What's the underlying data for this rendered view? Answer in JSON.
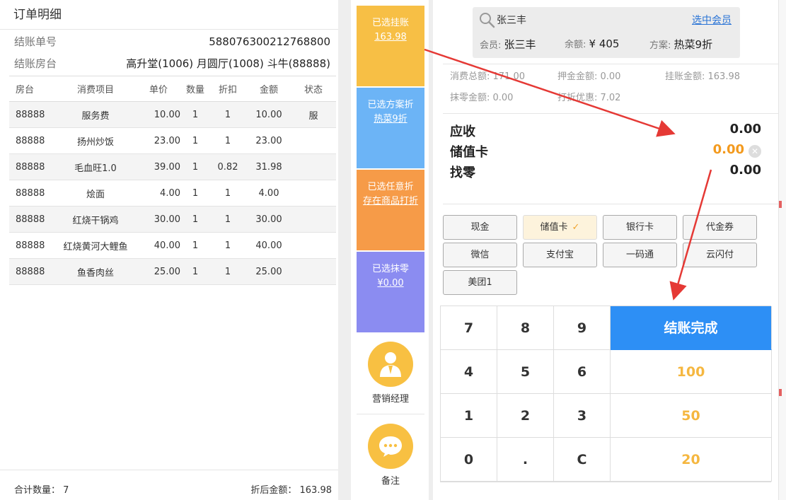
{
  "order": {
    "title": "订单明细",
    "no_label": "结账单号",
    "no_value": "588076300212768800",
    "rooms_label": "结账房台",
    "rooms_value": "高升堂(1006) 月圆厅(1008) 斗牛(88888)",
    "columns": [
      "房台",
      "消费项目",
      "单价",
      "数量",
      "折扣",
      "金额",
      "状态"
    ],
    "rows": [
      {
        "room": "88888",
        "item": "服务费",
        "price": "10.00",
        "qty": "1",
        "discount": "1",
        "amount": "10.00",
        "status": "服"
      },
      {
        "room": "88888",
        "item": "扬州炒饭",
        "price": "23.00",
        "qty": "1",
        "discount": "1",
        "amount": "23.00",
        "status": ""
      },
      {
        "room": "88888",
        "item": "毛血旺1.0",
        "price": "39.00",
        "qty": "1",
        "discount": "0.82",
        "amount": "31.98",
        "status": ""
      },
      {
        "room": "88888",
        "item": "烩面",
        "price": "4.00",
        "qty": "1",
        "discount": "1",
        "amount": "4.00",
        "status": ""
      },
      {
        "room": "88888",
        "item": "红烧干锅鸡",
        "price": "30.00",
        "qty": "1",
        "discount": "1",
        "amount": "30.00",
        "status": ""
      },
      {
        "room": "88888",
        "item": "红烧黄河大鲤鱼",
        "price": "40.00",
        "qty": "1",
        "discount": "1",
        "amount": "40.00",
        "status": ""
      },
      {
        "room": "88888",
        "item": "鱼香肉丝",
        "price": "25.00",
        "qty": "1",
        "discount": "1",
        "amount": "25.00",
        "status": ""
      }
    ],
    "total_qty_label": "合计数量：",
    "total_qty": "7",
    "discounted_label": "折后金额：",
    "discounted_value": "163.98"
  },
  "tiles": {
    "credit_label": "已选挂账",
    "credit_value": "163.98",
    "plan_label": "已选方案折",
    "plan_value": "热菜9折",
    "any_label": "已选任意折",
    "any_value": "存在商品打折",
    "round_label": "已选抹零",
    "round_value": "¥0.00",
    "manager_label": "营销经理",
    "note_label": "备注"
  },
  "member": {
    "search_value": "张三丰",
    "select_link": "选中会员",
    "name_label": "会员:",
    "name": "张三丰",
    "balance_label": "余额:",
    "balance": "¥ 405",
    "plan_label": "方案:",
    "plan": "热菜9折"
  },
  "stats": {
    "total_consume": "消费总额: 171.00",
    "deposit": "押金金额: 0.00",
    "credit": "挂账金额: 163.98",
    "rounding": "抹零金额: 0.00",
    "discount": "打折优惠: 7.02"
  },
  "amounts": {
    "receivable_label": "应收",
    "receivable": "0.00",
    "card_label": "储值卡",
    "card": "0.00",
    "change_label": "找零",
    "change": "0.00"
  },
  "payments": [
    "现金",
    "储值卡",
    "银行卡",
    "代金券",
    "微信",
    "支付宝",
    "一码通",
    "云闪付",
    "美团1"
  ],
  "payment_active": "储值卡",
  "keypad": {
    "keys": [
      "7",
      "8",
      "9",
      "4",
      "5",
      "6",
      "1",
      "2",
      "3",
      "0",
      ".",
      "C"
    ],
    "finish": "结账完成",
    "quick": [
      "100",
      "50",
      "20"
    ]
  },
  "colors": {
    "tile_yellow": "#f7bf45",
    "tile_blue": "#6cb4f6",
    "tile_orange": "#f69b48",
    "tile_purple": "#8b8cf1",
    "finish_blue": "#2d8ff5",
    "quick_amount": "#f5b740",
    "card_orange": "#f39a1e",
    "arrow_red": "#e53935"
  }
}
